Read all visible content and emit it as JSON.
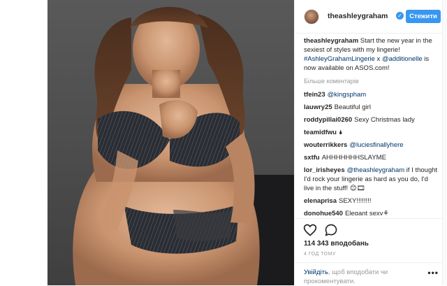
{
  "post": {
    "username": "theashleygraham",
    "follow_label": "Стежити",
    "caption": {
      "username": "theashleygraham",
      "text_a": "Start the new year in the sexiest of styles with my lingerie! ",
      "tag": "#AshleyGrahamLingerie",
      "text_b": " x ",
      "mention": "@additionelle",
      "text_c": " is now available on ASOS.com!"
    },
    "more_comments": "Більше коментарів",
    "comments": [
      {
        "user": "tfein23",
        "mention": "@kingspham",
        "text": ""
      },
      {
        "user": "lauwry25",
        "mention": "",
        "text": "Beautiful girl"
      },
      {
        "user": "roddypillai0260",
        "mention": "",
        "text": "Sexy Christmas lady"
      },
      {
        "user": "teamidfwu",
        "mention": "",
        "text": "🌢"
      },
      {
        "user": "wouterrikkers",
        "mention": "@luciesfinallyhere",
        "text": ""
      },
      {
        "user": "sxtfu",
        "mention": "",
        "text": "AHHHHHHHSLAYME"
      },
      {
        "user": "lor_irisheyes",
        "mention": "@theashleygraham",
        "text": " if I thought I'd rock your lingerie as hard as you do, I'd live in the stuff! 😊🎞"
      },
      {
        "user": "elenaprisa",
        "mention": "",
        "text": "SEXY!!!!!!!!"
      },
      {
        "user": "donohue540",
        "mention": "",
        "text": "Elegant sexy⚘"
      }
    ],
    "likes": "114 343 вподобань",
    "time": "4 ГОД ТОМУ",
    "login_link": "Увійдіть",
    "login_rest": ", щоб вподобати чи прокоментувати.",
    "options": "•••",
    "icons": {
      "like": "heart-icon",
      "comment": "comment-bubble-icon",
      "verified": "verified-badge-icon"
    }
  },
  "colors": {
    "accent": "#3897f0",
    "link": "#003569",
    "muted": "#999999"
  }
}
